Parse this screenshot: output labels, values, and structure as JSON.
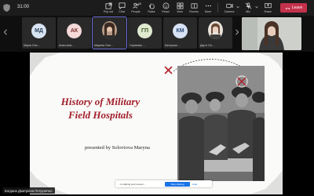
{
  "meeting": {
    "timer": "31:00"
  },
  "toolbar": {
    "buttons": [
      {
        "name": "pop-out-button",
        "label": "Pop out",
        "icon": "pop-out-icon"
      },
      {
        "name": "chat-button",
        "label": "Chat",
        "icon": "chat-icon"
      },
      {
        "name": "people-button",
        "label": "People",
        "icon": "people-icon",
        "badge": "16"
      },
      {
        "name": "raise-button",
        "label": "Raise",
        "icon": "hand-icon"
      },
      {
        "name": "react-button",
        "label": "React",
        "icon": "smile-icon"
      },
      {
        "name": "view-button",
        "label": "View",
        "icon": "grid-icon"
      },
      {
        "name": "rooms-button",
        "label": "Rooms",
        "icon": "rooms-icon"
      },
      {
        "name": "more-button",
        "label": "More",
        "icon": "ellipsis-icon"
      }
    ],
    "camera_label": "Camera",
    "mic_label": "Mic",
    "share_label": "Share",
    "leave_label": "Leave"
  },
  "participants": [
    {
      "initials": "МД",
      "name": "Марія Оле...",
      "color": "#d8e4f2",
      "text_color": "#30445e"
    },
    {
      "initials": "АК",
      "name": "Анастасія ...",
      "color": "#f4d9d9",
      "text_color": "#7a2d2d"
    },
    {
      "initials": "",
      "name": "Марина Оле...",
      "photo": true
    },
    {
      "initials": "ГП",
      "name": "Горпинюк ...",
      "color": "#dfe9cf",
      "text_color": "#3b5320"
    },
    {
      "initials": "КМ",
      "name": "Катерина ...",
      "color": "#d7e3f4",
      "text_color": "#2c4a77"
    },
    {
      "initials": "",
      "name": "Дар'я Ол...",
      "photo": true
    }
  ],
  "slide": {
    "title_line1": "History of Military",
    "title_line2": "Field Hospitals",
    "subtitle": "presented by Soloviova Maryna"
  },
  "share_notice": {
    "text": "... is sharing your screen ...",
    "stop_label": "Stop sharing",
    "hide_label": "Hide"
  },
  "presenter_label": "Богдана Дмитрівна Петрунечко"
}
